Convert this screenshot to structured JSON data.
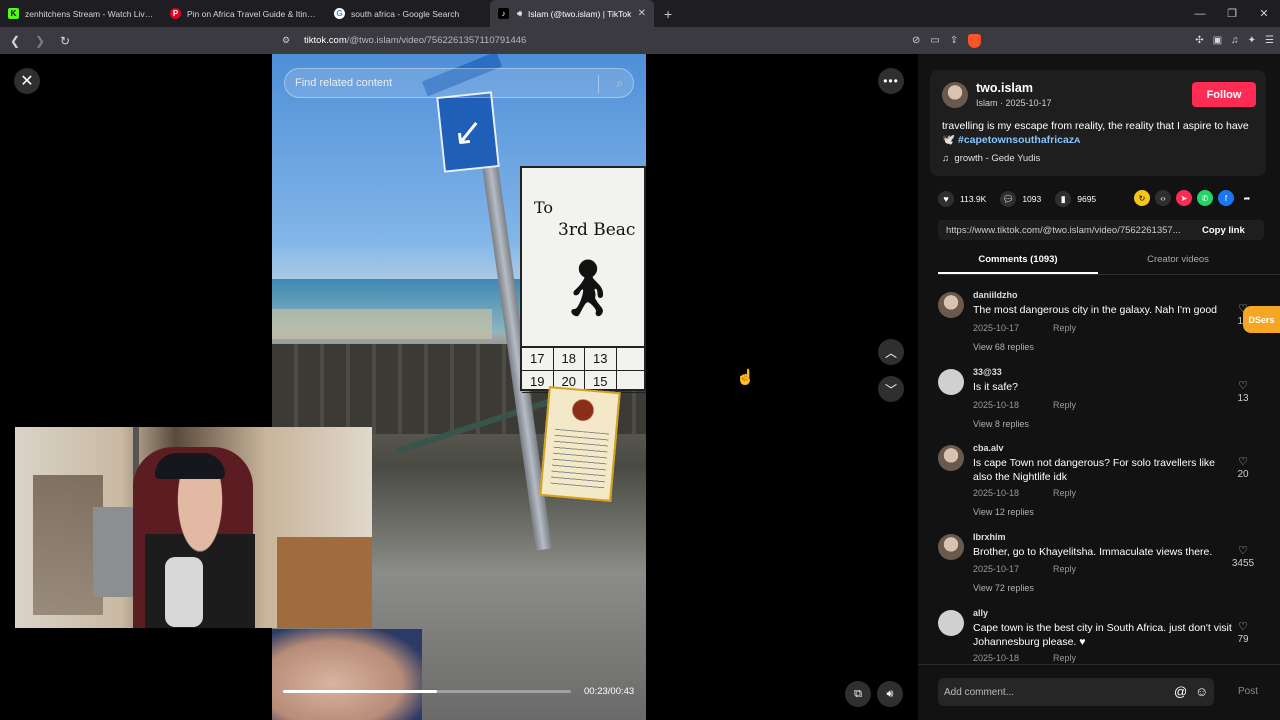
{
  "browser": {
    "tabs": [
      {
        "title": "zenhitchens Stream - Watch Live on K",
        "icon": "kick-icon",
        "color": "#53fc18"
      },
      {
        "title": "Pin on Africa Travel Guide & Itinerari",
        "icon": "pinterest-icon",
        "color": "#e60023"
      },
      {
        "title": "south africa - Google Search",
        "icon": "google-icon",
        "color": "#4285f4"
      },
      {
        "title": "Islam (@two.islam) | TikTok",
        "icon": "tiktok-icon",
        "color": "#000000"
      }
    ],
    "url_host": "tiktok.com",
    "url_path": "/@two.islam/video/7562261357110791446"
  },
  "video": {
    "search_placeholder": "Find related content",
    "sign_title": "To",
    "sign_subtitle": "3rd Beac",
    "sign_numbers": [
      "17",
      "18",
      "13",
      "",
      "19",
      "20",
      "15",
      ""
    ],
    "time": "00:23/00:43",
    "progress": 0.535
  },
  "post": {
    "username": "two.islam",
    "meta": "Islam · 2025-10-17",
    "follow_label": "Follow",
    "caption": "travelling is my escape from reality, the reality that I aspire to have 🕊️",
    "hashtag": "#capetownsouthafricaᴢᴀ",
    "music": "growth - Gede Yudis",
    "likes": "113.9K",
    "comments": "1093",
    "saves": "9695",
    "link": "https://www.tiktok.com/@two.islam/video/7562261357...",
    "copy_label": "Copy link"
  },
  "panel_tabs": {
    "comments": "Comments (1093)",
    "creator": "Creator videos"
  },
  "comments": [
    {
      "user": "daniildzho",
      "text": "The most dangerous city in the galaxy. Nah I'm good",
      "date": "2025-10-17",
      "reply": "Reply",
      "view": "View 68 replies",
      "likes": "12"
    },
    {
      "user": "33@33",
      "text": "Is it safe?",
      "date": "2025-10-18",
      "reply": "Reply",
      "view": "View 8 replies",
      "likes": "13"
    },
    {
      "user": "cba.alv",
      "text": "Is cape Town not dangerous? For solo travellers like also the Nightlife idk",
      "date": "2025-10-18",
      "reply": "Reply",
      "view": "View 12 replies",
      "likes": "20"
    },
    {
      "user": "Ibrxhim",
      "text": "Brother, go to Khayelitsha. Immaculate views there.",
      "date": "2025-10-17",
      "reply": "Reply",
      "view": "View 72 replies",
      "likes": "3455"
    },
    {
      "user": "ally",
      "text": "Cape town is the best city in South Africa. just don't visit Johannesburg please. ♥",
      "date": "2025-10-18",
      "reply": "Reply",
      "view": "",
      "likes": "79"
    }
  ],
  "composer": {
    "placeholder": "Add comment...",
    "post_label": "Post"
  },
  "extension_badge": "DSers"
}
